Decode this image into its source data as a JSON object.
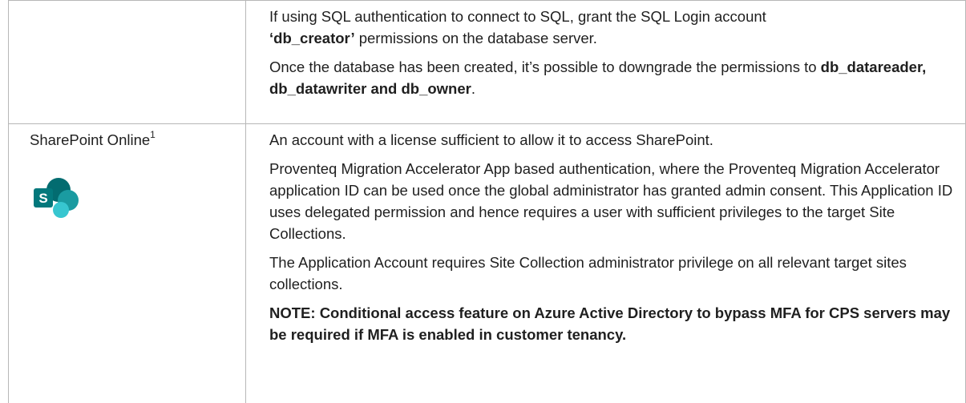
{
  "row1": {
    "para1_text": "If using SQL authentication to connect to SQL, grant the SQL Login account",
    "para1_bold": "‘db_creator’",
    "para1_tail": " permissions on the database server.",
    "para2_text": "Once the database has been created, it’s possible to downgrade the permissions to ",
    "para2_bold": "db_datareader, db_datawriter and db_owner",
    "para2_tail": "."
  },
  "row2": {
    "left_label": "SharePoint Online",
    "left_sup": "1",
    "logo_letter": "S",
    "logo_icon": "sharepoint-logo-icon",
    "colors": {
      "logo_dark": "#036C70",
      "logo_mid": "#1A9BA1",
      "logo_light": "#37C6D0",
      "logo_letter_bg": "#03787C"
    },
    "para1": "An account with a license sufficient to allow it to access SharePoint.",
    "para2": "Proventeq Migration Accelerator App based authentication, where the Proventeq Migration Accelerator application ID can be used once the global administrator has granted admin consent. This Application ID uses delegated permission and hence requires a user with sufficient privileges to the target Site Collections.",
    "para3": "The Application Account requires Site Collection administrator privilege on all relevant target sites collections.",
    "note": "NOTE: Conditional access feature on Azure Active Directory to bypass MFA for CPS servers may be required if MFA is enabled in customer tenancy."
  }
}
